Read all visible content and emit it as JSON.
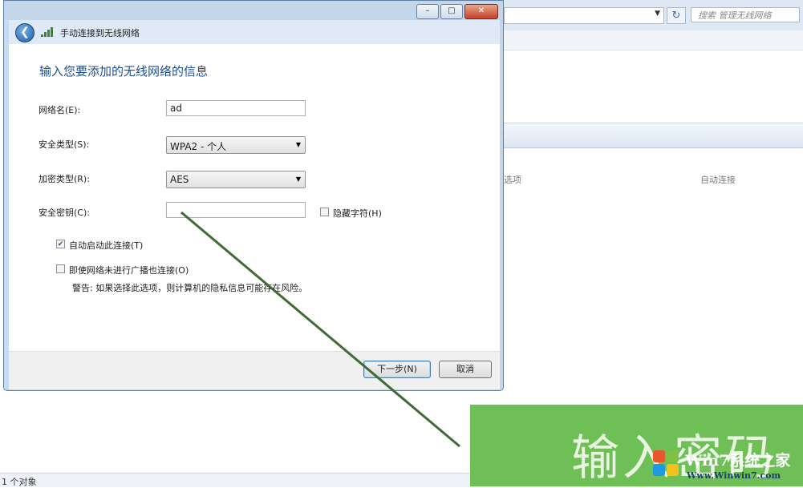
{
  "background_window": {
    "search_placeholder": "搜索 管理无线网络",
    "refresh_icon": "↻",
    "column_headers": [
      "选项",
      "自动连接"
    ],
    "status_text": "1 个对象"
  },
  "dialog": {
    "title": "手动连接到无线网络",
    "heading": "输入您要添加的无线网络的信息",
    "network_name": {
      "label": "网络名(E):",
      "value": "ad"
    },
    "security_type": {
      "label": "安全类型(S):",
      "value": "WPA2 - 个人"
    },
    "encryption_type": {
      "label": "加密类型(R):",
      "value": "AES"
    },
    "security_key": {
      "label": "安全密钥(C):",
      "value": ""
    },
    "hide_chars": {
      "label": "隐藏字符(H)",
      "checked": false
    },
    "auto_start": {
      "label": "自动启动此连接(T)",
      "checked": true
    },
    "connect_hidden": {
      "label": "即使网络未进行广播也连接(O)",
      "checked": false
    },
    "warning": "警告: 如果选择此选项，则计算机的隐私信息可能存在风险。",
    "next_button": "下一步(N)",
    "cancel_button": "取消",
    "window_buttons": {
      "minimize": "–",
      "maximize": "□",
      "close": "✕"
    }
  },
  "overlay": {
    "caption": "输入密码",
    "watermark": "Win7系统之家",
    "watermark_url": "Www.Winwin7.com"
  },
  "colors": {
    "heading_blue": "#1e4f8f",
    "arrow_green": "#3f6b34",
    "banner_green": "#6fbf57"
  }
}
